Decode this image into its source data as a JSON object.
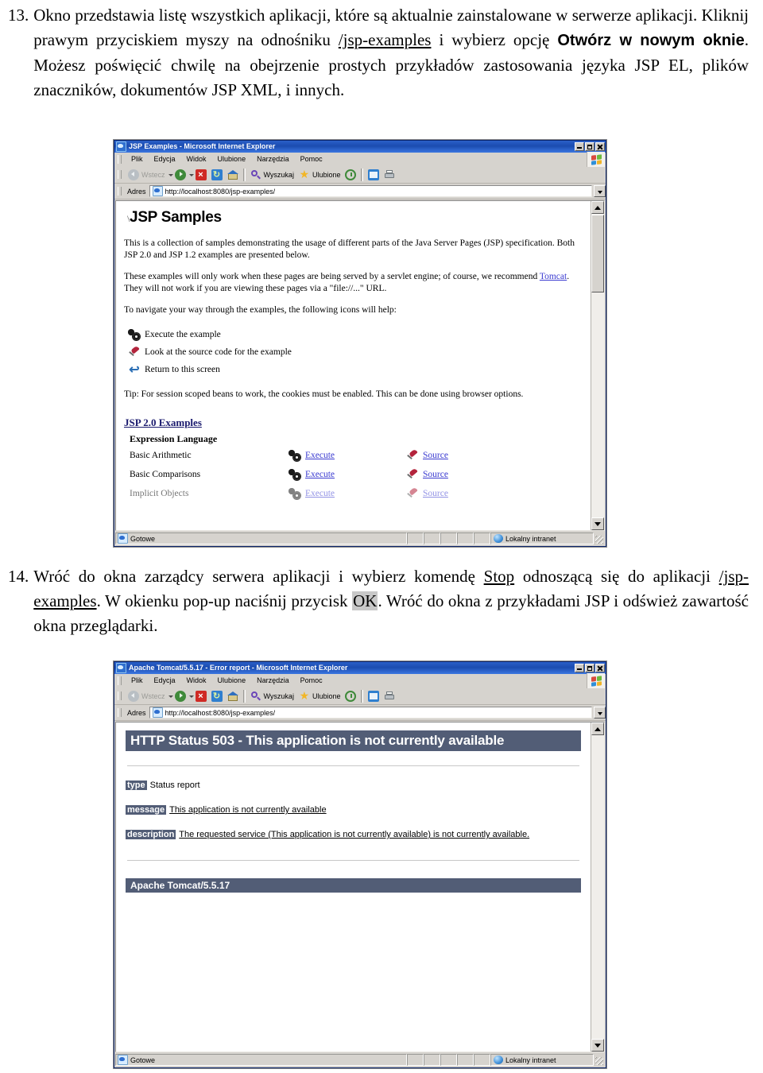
{
  "steps": [
    {
      "number": "13.",
      "segments": [
        {
          "t": "Okno przedstawia listę wszystkich aplikacji, które są aktualnie zainstalowane w serwerze aplikacji. Kliknij prawym przyciskiem myszy na odnośniku ",
          "style": "normal"
        },
        {
          "t": "/jsp-examples",
          "style": "underline"
        },
        {
          "t": " i wybierz opcję ",
          "style": "normal"
        },
        {
          "t": "Otwórz w nowym oknie",
          "style": "sans-bold"
        },
        {
          "t": ". Możesz poświęcić chwilę na obejrzenie prostych przykładów zastosowania języka JSP EL, plików znaczników, dokumentów JSP XML, i innych.",
          "style": "normal"
        }
      ]
    },
    {
      "number": "14.",
      "segments": [
        {
          "t": "Wróć do okna zarządcy serwera aplikacji i wybierz komendę ",
          "style": "normal"
        },
        {
          "t": "Stop",
          "style": "underline"
        },
        {
          "t": " odnoszącą się do aplikacji ",
          "style": "normal"
        },
        {
          "t": "/jsp-examples",
          "style": "underline"
        },
        {
          "t": ". W okienku pop-up naciśnij przycisk ",
          "style": "normal"
        },
        {
          "t": "OK",
          "style": "highlight"
        },
        {
          "t": ". Wróć do okna z przykładami JSP i odśwież zawartość okna przeglądarki.",
          "style": "normal"
        }
      ]
    }
  ],
  "chrome": {
    "menu": [
      {
        "label": "Plik",
        "accel": "P"
      },
      {
        "label": "Edycja",
        "accel": "E"
      },
      {
        "label": "Widok",
        "accel": "W"
      },
      {
        "label": "Ulubione",
        "accel": "U"
      },
      {
        "label": "Narzędzia",
        "accel": "N"
      },
      {
        "label": "Pomoc",
        "accel": "P"
      }
    ],
    "toolbar": {
      "back_label": "Wstecz",
      "search_label": "Wyszukaj",
      "favorites_label": "Ulubione"
    },
    "address_label": "Adres",
    "status_ready": "Gotowe",
    "status_zone": "Lokalny intranet",
    "buttons": {
      "minimize": "Minimalizuj",
      "maximize": "Maksymalizuj",
      "close": "Zamknij"
    }
  },
  "window1": {
    "title": "JSP Examples - Microsoft Internet Explorer",
    "url": "http://localhost:8080/jsp-examples/",
    "page": {
      "slash": "\\",
      "heading": "JSP Samples",
      "paragraph1": "This is a collection of samples demonstrating the usage of different parts of the Java Server Pages (JSP) specification. Both JSP 2.0 and JSP 1.2 examples are presented below.",
      "paragraph2_a": "These examples will only work when these pages are being served by a servlet engine; of course, we recommend ",
      "paragraph2_link": "Tomcat",
      "paragraph2_b": ". They will not work if you are viewing these pages via a \"file://...\" URL.",
      "navigate_intro": "To navigate your way through the examples, the following icons will help:",
      "legend": [
        {
          "icon": "gears-icon",
          "text": "Execute the example"
        },
        {
          "icon": "pen-icon",
          "text": "Look at the source code for the example"
        },
        {
          "icon": "return-arrow-icon",
          "text": "Return to this screen"
        }
      ],
      "tip": "Tip: For session scoped beans to work, the cookies must be enabled. This can be done using browser options.",
      "section_title": "JSP 2.0 Examples",
      "subsection_title": "Expression Language",
      "execute_label": "Execute",
      "source_label": "Source",
      "examples": [
        {
          "name": "Basic Arithmetic"
        },
        {
          "name": "Basic Comparisons"
        },
        {
          "name": "Implicit Objects"
        }
      ]
    }
  },
  "window2": {
    "title": "Apache Tomcat/5.5.17 - Error report - Microsoft Internet Explorer",
    "url": "http://localhost:8080/jsp-examples/",
    "page": {
      "banner": "HTTP Status 503 - This application is not currently available",
      "rows": [
        {
          "tag": "type",
          "value": "Status report",
          "underlined": false
        },
        {
          "tag": "message",
          "value": "This application is not currently available",
          "underlined": true
        },
        {
          "tag": "description",
          "value": "The requested service (This application is not currently available) is not currently available.",
          "underlined": true
        }
      ],
      "footer": "Apache Tomcat/5.5.17"
    }
  },
  "colors": {
    "tomcat_banner": "#525d76",
    "titlebar_blue": "#1b4cb0",
    "chrome_gray": "#d6d3ce",
    "link_blue": "#3a3ad0",
    "highlight_gray": "#c8c8c8"
  }
}
